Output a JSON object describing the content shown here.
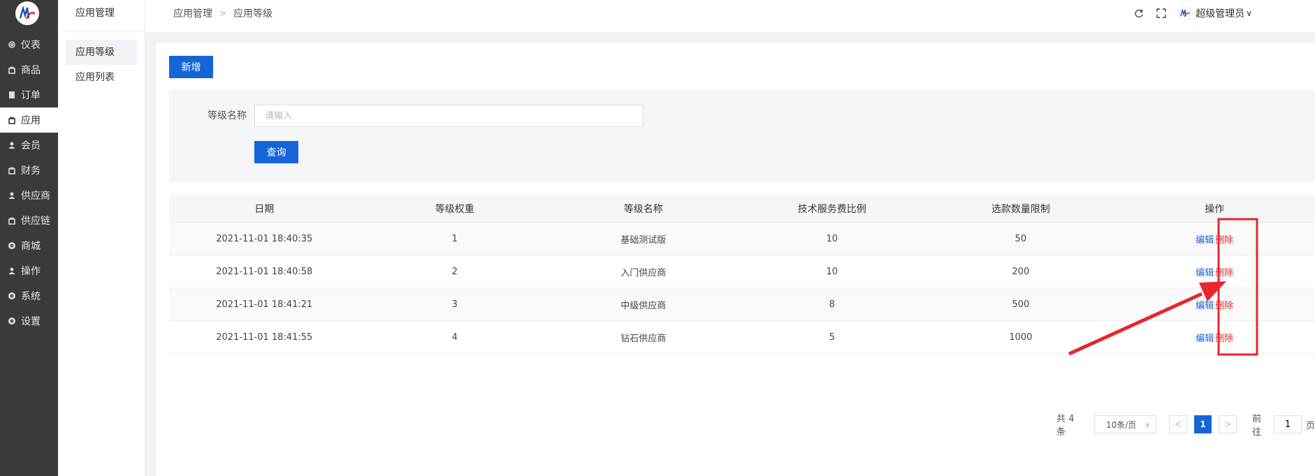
{
  "sidebar": {
    "items": [
      {
        "label": "仪表",
        "icon": "gear-icon"
      },
      {
        "label": "商品",
        "icon": "bag-icon"
      },
      {
        "label": "订单",
        "icon": "clipboard-icon"
      },
      {
        "label": "应用",
        "icon": "bag-icon",
        "active": true
      },
      {
        "label": "会员",
        "icon": "user-icon"
      },
      {
        "label": "财务",
        "icon": "bag-icon"
      },
      {
        "label": "供应商",
        "icon": "user-icon"
      },
      {
        "label": "供应链",
        "icon": "bag-icon"
      },
      {
        "label": "商城",
        "icon": "gear-icon"
      },
      {
        "label": "操作",
        "icon": "user-icon"
      },
      {
        "label": "系统",
        "icon": "gear-icon"
      },
      {
        "label": "设置",
        "icon": "gear-icon"
      }
    ]
  },
  "submenu": {
    "title": "应用管理",
    "items": [
      "应用等级",
      "应用列表"
    ]
  },
  "header": {
    "breadcrumb": [
      "应用管理",
      "应用等级"
    ],
    "user_name": "超级管理员"
  },
  "toolbar": {
    "add_label": "新增"
  },
  "search": {
    "label": "等级名称",
    "placeholder": "请输入",
    "value": "",
    "query_label": "查询"
  },
  "table": {
    "columns": [
      "日期",
      "等级权重",
      "等级名称",
      "技术服务费比例",
      "选款数量限制",
      "操作"
    ],
    "rows": [
      {
        "date": "2021-11-01 18:40:35",
        "weight": "1",
        "name": "基础测试版",
        "fee": "10",
        "limit": "50"
      },
      {
        "date": "2021-11-01 18:40:58",
        "weight": "2",
        "name": "入门供应商",
        "fee": "10",
        "limit": "200"
      },
      {
        "date": "2021-11-01 18:41:21",
        "weight": "3",
        "name": "中级供应商",
        "fee": "8",
        "limit": "500"
      },
      {
        "date": "2021-11-01 18:41:55",
        "weight": "4",
        "name": "钻石供应商",
        "fee": "5",
        "limit": "1000"
      }
    ],
    "edit_label": "编辑",
    "delete_label": "删除"
  },
  "pagination": {
    "total": "共 4 条",
    "page_size": "10条/页",
    "current_page": "1",
    "goto_prefix": "前往",
    "goto_value": "1",
    "goto_suffix": "页"
  },
  "colors": {
    "primary": "#1565d8",
    "danger": "#e02424",
    "annotation": "#e8262b",
    "sidebar_bg": "#3a3a3a"
  }
}
